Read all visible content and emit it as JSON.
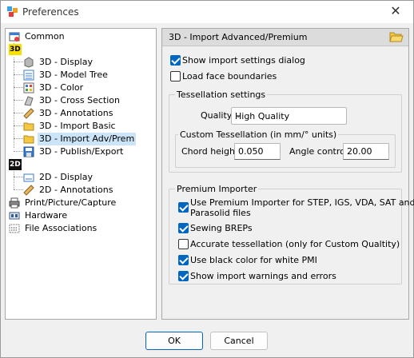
{
  "window": {
    "title": "Preferences",
    "close_glyph": "✕"
  },
  "tree": {
    "common": "Common",
    "group3d_badge": "3D",
    "items3d": [
      "3D - Display",
      "3D - Model Tree",
      "3D - Color",
      "3D - Cross Section",
      "3D - Annotations",
      "3D - Import Basic",
      "3D - Import Adv/Prem",
      "3D - Publish/Export"
    ],
    "group2d_badge": "2D",
    "items2d": [
      "2D - Display",
      "2D - Annotations"
    ],
    "others": [
      "Print/Picture/Capture",
      "Hardware",
      "File Associations"
    ],
    "selected": "3D - Import Adv/Prem"
  },
  "panel": {
    "title": "3D - Import Advanced/Premium",
    "show_import_settings": {
      "label": "Show import settings dialog",
      "checked": true
    },
    "load_face_boundaries": {
      "label": "Load face boundaries",
      "checked": false
    },
    "tessellation": {
      "title": "Tessellation settings",
      "quality_label": "Quality",
      "quality_value": "High Quality",
      "custom": {
        "title": "Custom Tessellation (in mm/° units)",
        "chord_label": "Chord height",
        "chord_value": "0.050",
        "angle_label": "Angle control",
        "angle_value": "20.00"
      }
    },
    "premium": {
      "title": "Premium Importer",
      "use_premium": {
        "label_line1": "Use Premium Importer for STEP, IGS, VDA, SAT and",
        "label_line2": "Parasolid files",
        "checked": true
      },
      "sewing": {
        "label": "Sewing BREPs",
        "checked": true
      },
      "accurate": {
        "label": "Accurate tessellation (only for Custom Qualtity)",
        "checked": false
      },
      "black_color": {
        "label": "Use black color for white PMI",
        "checked": true
      },
      "warnings": {
        "label": "Show import warnings and errors",
        "checked": true
      }
    }
  },
  "buttons": {
    "ok": "OK",
    "cancel": "Cancel"
  },
  "colors": {
    "accent": "#0067c0",
    "selection": "#cce4f7"
  }
}
